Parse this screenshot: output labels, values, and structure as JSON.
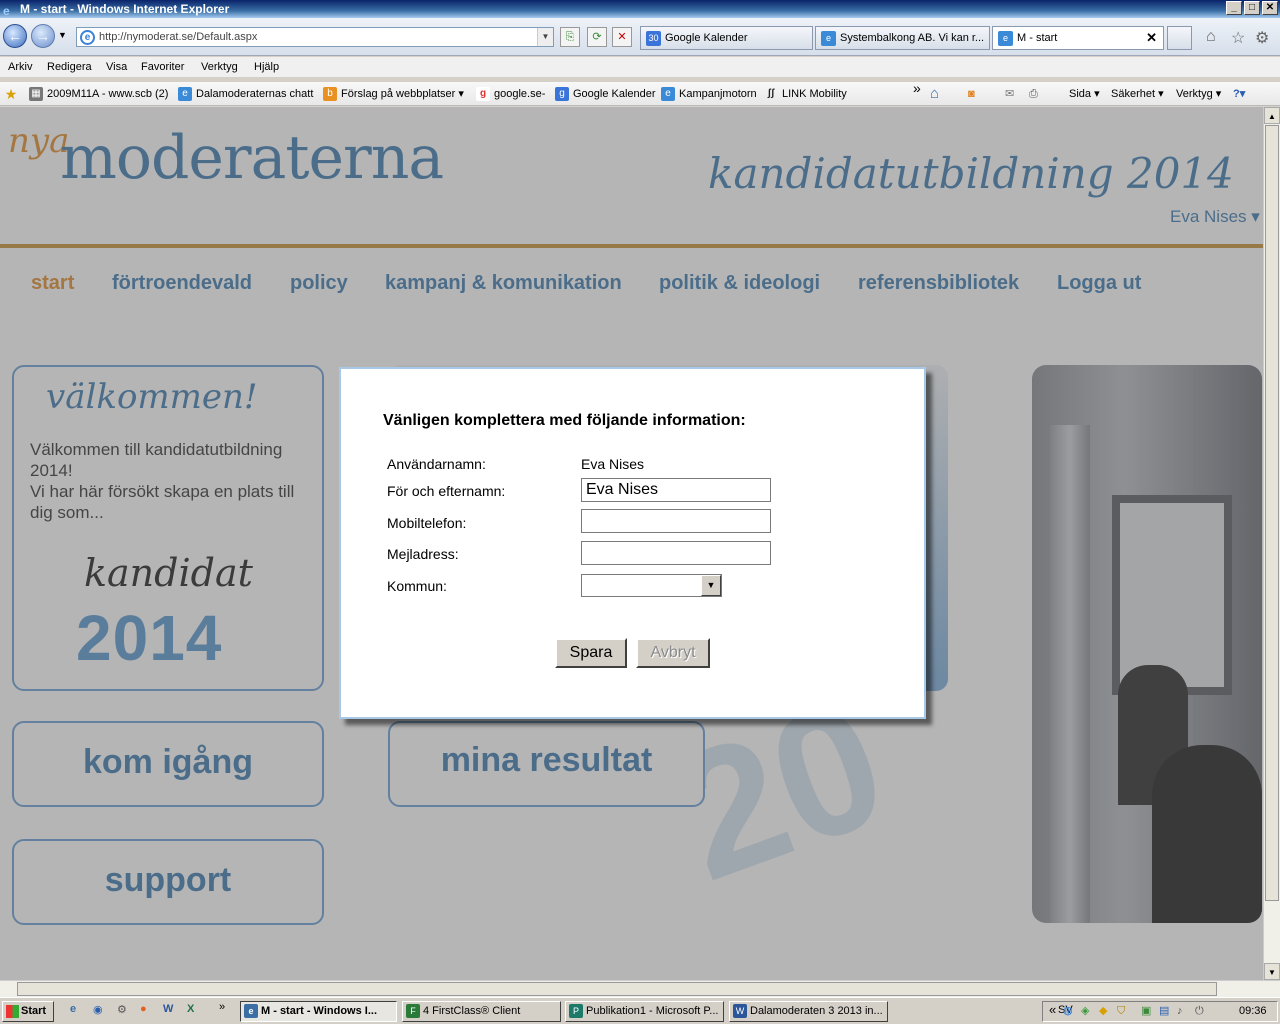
{
  "window": {
    "title": "M - start - Windows Internet Explorer"
  },
  "browser": {
    "address": "http://nymoderat.se/Default.aspx",
    "tabs": [
      {
        "label": "Google Kalender",
        "icon": "30"
      },
      {
        "label": "Systembalkong AB. Vi kan r...",
        "icon": "e"
      },
      {
        "label": "M - start",
        "icon": "e"
      }
    ],
    "menu": [
      "Arkiv",
      "Redigera",
      "Visa",
      "Favoriter",
      "Verktyg",
      "Hjälp"
    ],
    "favorites": [
      {
        "label": "2009M11A - www.scb (2)"
      },
      {
        "label": "Dalamoderaternas chatt"
      },
      {
        "label": "Förslag på webbplatser ▾"
      },
      {
        "label": "google.se-"
      },
      {
        "label": "Google Kalender"
      },
      {
        "label": "Kampanjmotorn"
      },
      {
        "label": "LINK Mobility"
      }
    ],
    "tools": [
      "Sida ▾",
      "Säkerhet ▾",
      "Verktyg ▾"
    ],
    "double_chevron": "»"
  },
  "page": {
    "logo_nya": "nya",
    "logo_main": "moderaterna",
    "slogan": "kandidatutbildning 2014",
    "user_name": "Eva Nises ▾",
    "nav": [
      "start",
      "förtroendevald",
      "policy",
      "kampanj & komunikation",
      "politik & ideologi",
      "referensbibliotek",
      "Logga ut"
    ],
    "welcome": {
      "title": "välkommen!",
      "text": "Välkommen till kandidatutbildning 2014!\nVi har här försökt skapa en plats till dig som...",
      "kandidat": "kandidat",
      "year": "2014"
    },
    "cards": {
      "kom_igang": "kom igång",
      "mina_resultat": "mina resultat",
      "support": "support"
    }
  },
  "dialog": {
    "title": "Vänligen komplettera med följande information:",
    "fields": {
      "username_label": "Användarnamn:",
      "username_value": "Eva Nises",
      "fullname_label": "För och efternamn:",
      "fullname_value": "Eva Nises",
      "mobile_label": "Mobiltelefon:",
      "mobile_value": "",
      "email_label": "Mejladress:",
      "email_value": "",
      "kommun_label": "Kommun:",
      "kommun_value": ""
    },
    "save_label": "Spara",
    "cancel_label": "Avbryt"
  },
  "taskbar": {
    "start": "Start",
    "items": [
      {
        "label": "M - start - Windows I...",
        "icon": "e",
        "color": "#3a6ea5"
      },
      {
        "label": "4 FirstClass® Client",
        "icon": "F",
        "color": "#2a7a3a"
      },
      {
        "label": "Publikation1 - Microsoft P...",
        "icon": "P",
        "color": "#1d7a6a"
      },
      {
        "label": "Dalamoderaten 3 2013 in...",
        "icon": "W",
        "color": "#2b579a"
      }
    ],
    "lang": "SV",
    "clock": "09:36"
  },
  "colors": {
    "brand_blue": "#3e7cb1",
    "brand_orange": "#e08d2f"
  }
}
